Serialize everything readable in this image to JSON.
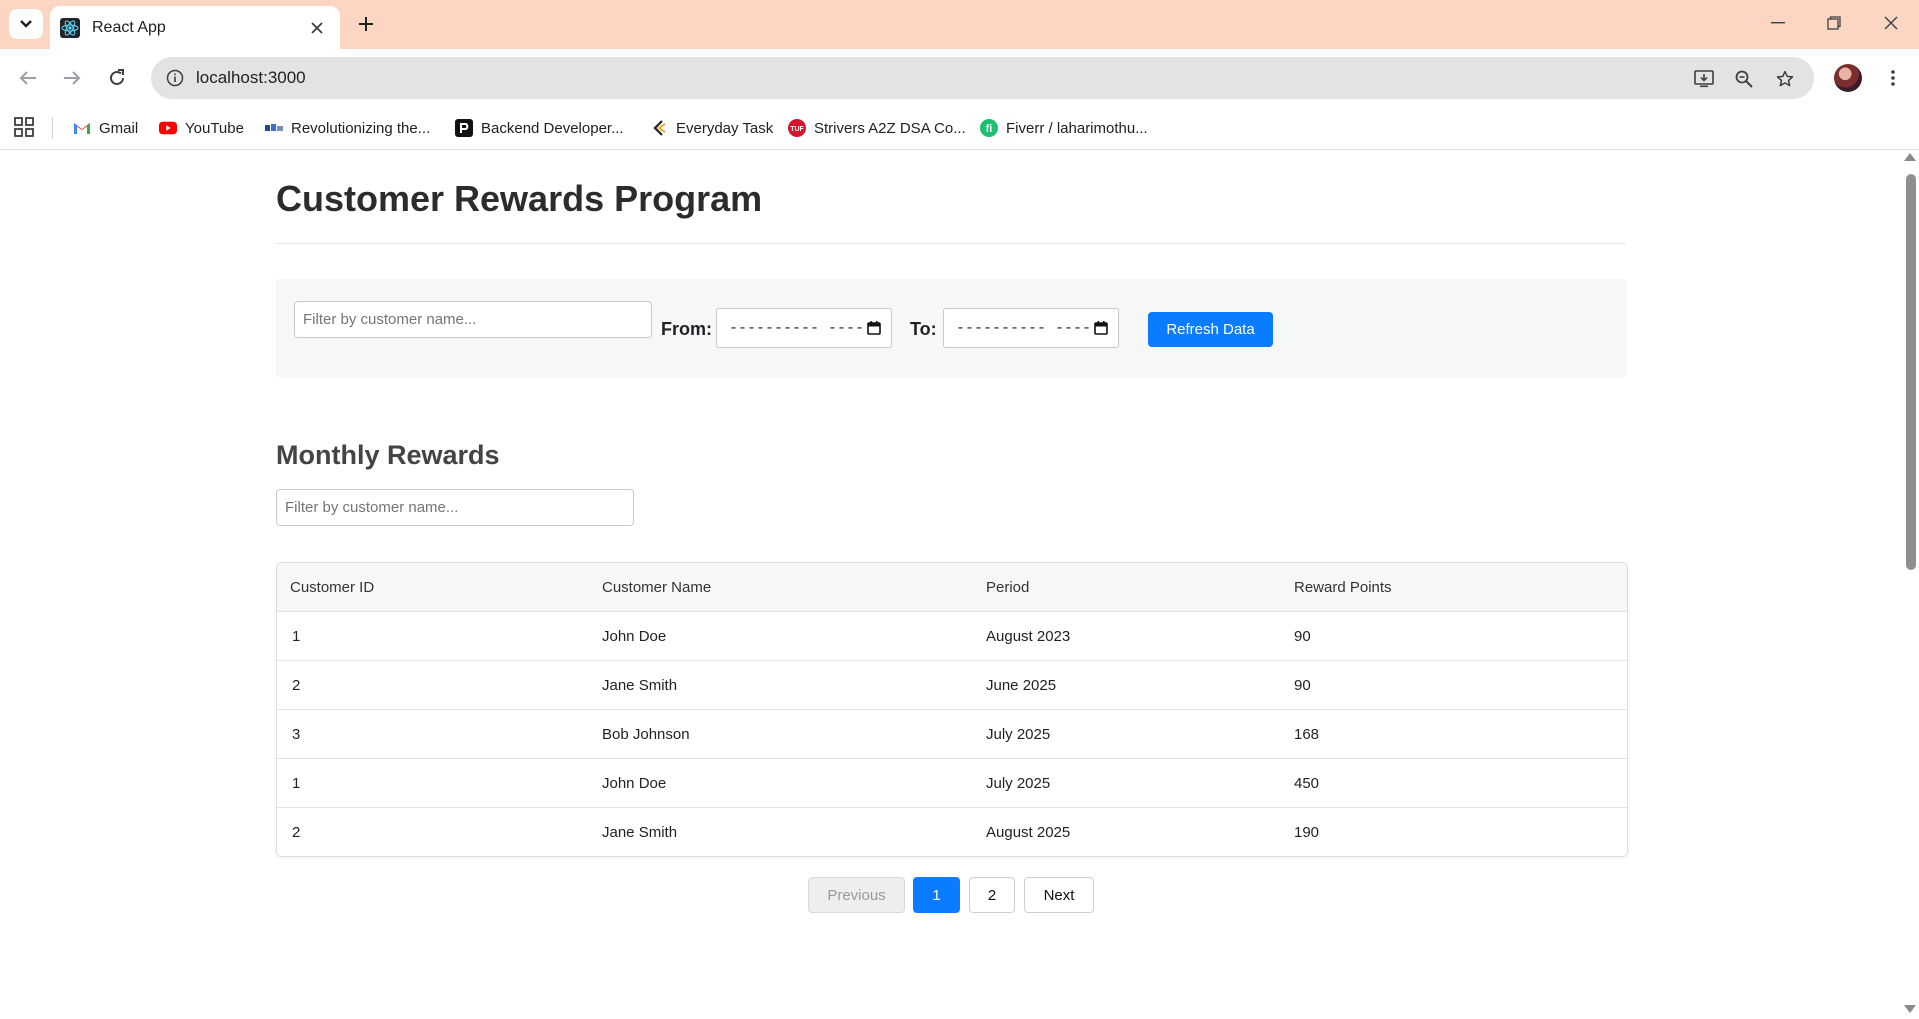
{
  "browser": {
    "tab_title": "React App",
    "tab_icon": "react-logo-icon",
    "url": "localhost:3000",
    "bookmarks": [
      {
        "label": "Gmail",
        "icon": "gmail-icon"
      },
      {
        "label": "YouTube",
        "icon": "youtube-icon"
      },
      {
        "label": "Revolutionizing the...",
        "icon": "site-icon"
      },
      {
        "label": "Backend Developer...",
        "icon": "roadmap-icon"
      },
      {
        "label": "Everyday Task",
        "icon": "task-icon"
      },
      {
        "label": "Strivers A2Z DSA Co...",
        "icon": "tuf-icon"
      },
      {
        "label": "Fiverr / laharimothu...",
        "icon": "fiverr-icon"
      }
    ]
  },
  "app": {
    "title": "Customer Rewards Program",
    "filters": {
      "name_placeholder": "Filter by customer name...",
      "from_label": "From:",
      "to_label": "To:",
      "from_value": "---------- ----",
      "to_value": "---------- ----",
      "refresh_label": "Refresh Data"
    },
    "monthly": {
      "heading": "Monthly Rewards",
      "filter_placeholder": "Filter by customer name...",
      "columns": [
        "Customer ID",
        "Customer Name",
        "Period",
        "Reward Points"
      ],
      "rows": [
        {
          "id": "1",
          "name": "John Doe",
          "period": "August 2023",
          "points": "90"
        },
        {
          "id": "2",
          "name": "Jane Smith",
          "period": "June 2025",
          "points": "90"
        },
        {
          "id": "3",
          "name": "Bob Johnson",
          "period": "July 2025",
          "points": "168"
        },
        {
          "id": "1",
          "name": "John Doe",
          "period": "July 2025",
          "points": "450"
        },
        {
          "id": "2",
          "name": "Jane Smith",
          "period": "August 2025",
          "points": "190"
        }
      ]
    },
    "pagination": {
      "previous": "Previous",
      "pages": [
        "1",
        "2"
      ],
      "current": "1",
      "next": "Next"
    }
  },
  "colors": {
    "accent": "#0a7cff",
    "tabstrip": "#fcd6c3"
  }
}
